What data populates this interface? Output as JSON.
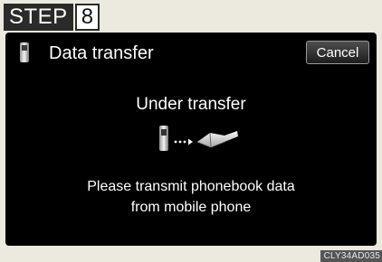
{
  "step": {
    "word": "STEP",
    "number": "8"
  },
  "screen": {
    "title_icon": "mobile-phone-icon",
    "title": "Data transfer",
    "cancel_label": "Cancel",
    "status": "Under transfer",
    "transfer_icons": [
      "mobile-phone-icon",
      "arrow-dots-icon",
      "phonebook-icon"
    ],
    "message_line1": "Please transmit phonebook data",
    "message_line2": "from mobile phone"
  },
  "figure_code": "CLY34AD035",
  "colors": {
    "screen_bg": "#000000",
    "page_bg": "#ece9de",
    "text": "#ffffff"
  }
}
